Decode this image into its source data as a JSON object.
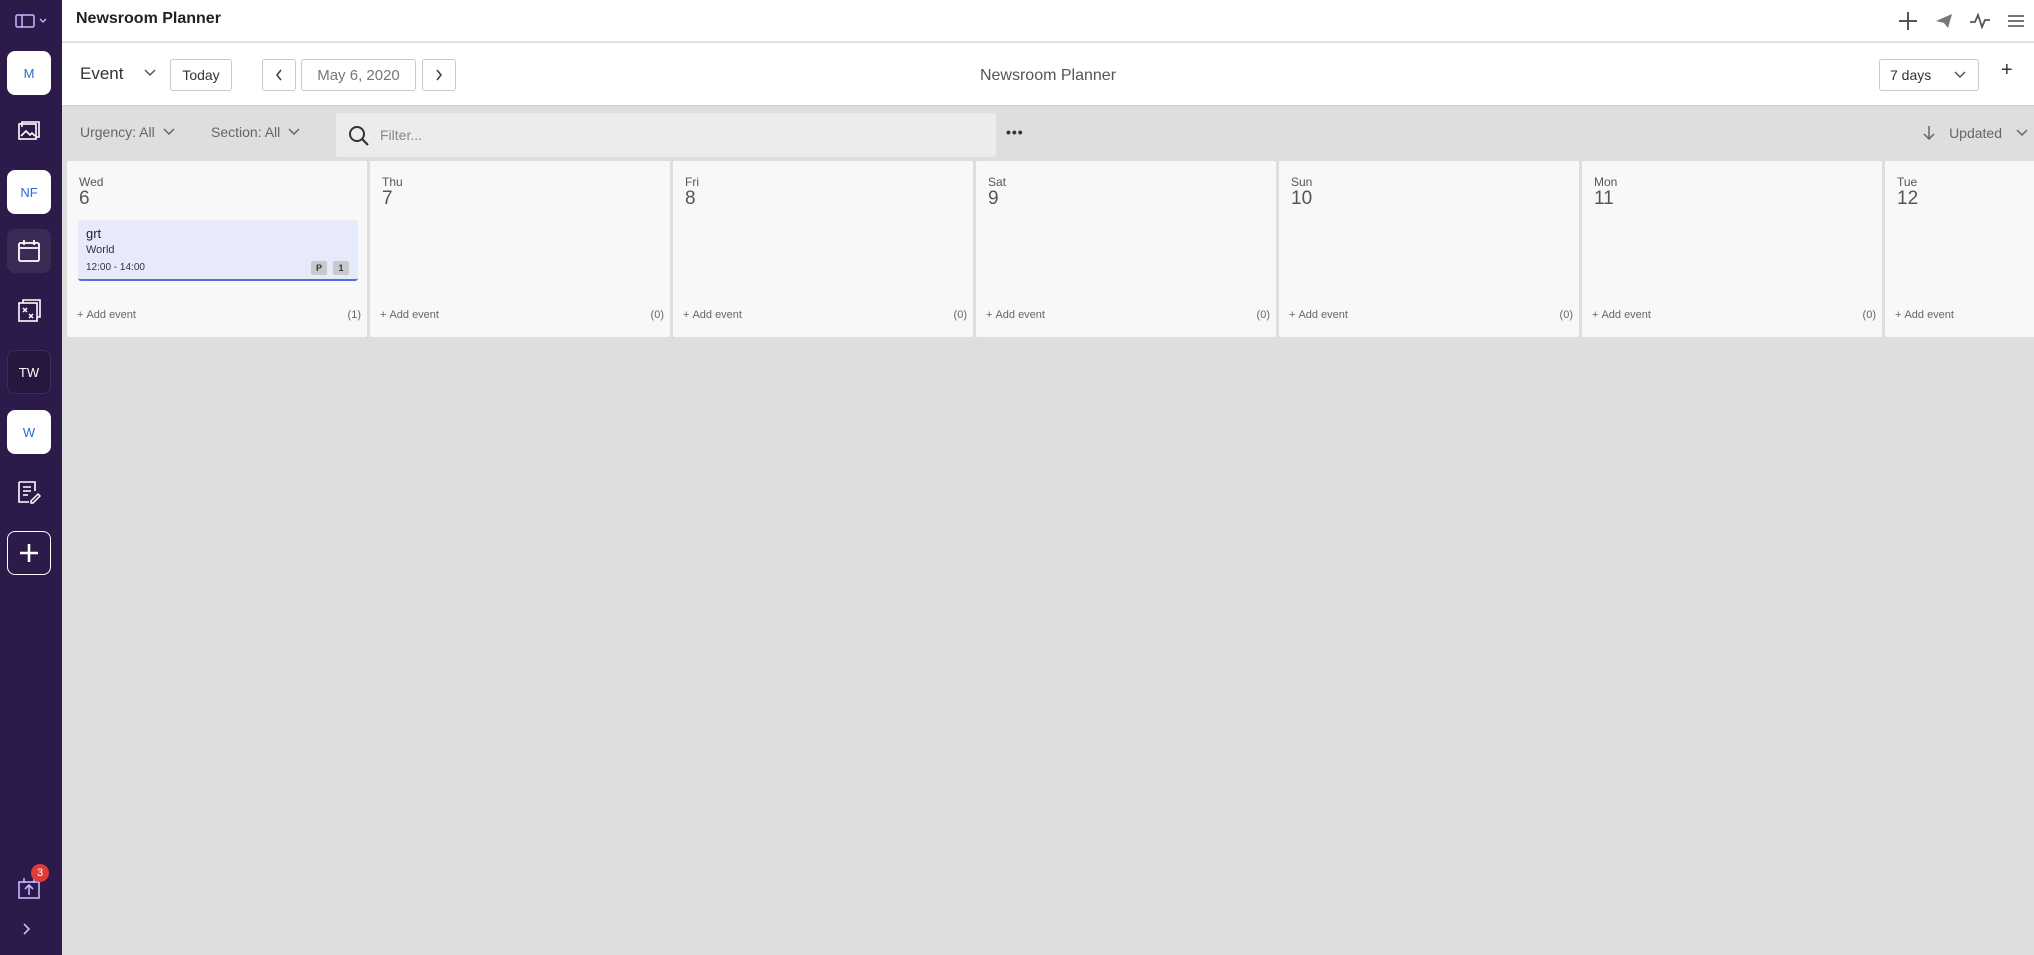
{
  "app": {
    "title": "Newsroom Planner"
  },
  "rail": {
    "items": [
      {
        "label": "M",
        "name": "monitoring"
      },
      {
        "label": "",
        "name": "media"
      },
      {
        "label": "NF",
        "name": "nf-desk"
      },
      {
        "label": "",
        "name": "planning"
      },
      {
        "label": "",
        "name": "assignments"
      },
      {
        "label": "TW",
        "name": "tw-desk"
      },
      {
        "label": "W",
        "name": "w-desk"
      },
      {
        "label": "",
        "name": "content"
      },
      {
        "label": "",
        "name": "create"
      }
    ],
    "notifications_count": "3"
  },
  "toolbar": {
    "type_label": "Event",
    "today_label": "Today",
    "date_value": "May 6, 2020",
    "center_title": "Newsroom Planner",
    "range_label": "7 days",
    "add_label": "+"
  },
  "filters": {
    "urgency_label": "Urgency: All",
    "section_label": "Section: All",
    "search_placeholder": "Filter...",
    "more_label": "•••",
    "sort_label": "Updated"
  },
  "calendar": {
    "days": [
      {
        "name": "Wed",
        "date": "6",
        "count": "(1)",
        "add_label": "Add event",
        "events": [
          {
            "title": "grt",
            "section": "World",
            "time": "12:00 - 14:00",
            "tags": [
              "P",
              "1"
            ]
          }
        ]
      },
      {
        "name": "Thu",
        "date": "7",
        "count": "(0)",
        "add_label": "Add event",
        "events": []
      },
      {
        "name": "Fri",
        "date": "8",
        "count": "(0)",
        "add_label": "Add event",
        "events": []
      },
      {
        "name": "Sat",
        "date": "9",
        "count": "(0)",
        "add_label": "Add event",
        "events": []
      },
      {
        "name": "Sun",
        "date": "10",
        "count": "(0)",
        "add_label": "Add event",
        "events": []
      },
      {
        "name": "Mon",
        "date": "11",
        "count": "(0)",
        "add_label": "Add event",
        "events": []
      },
      {
        "name": "Tue",
        "date": "12",
        "count": "",
        "add_label": "Add event",
        "events": []
      }
    ]
  },
  "colors": {
    "rail_bg": "#2c1a4a",
    "event_bg": "#e6eafa",
    "event_accent": "#4f6fd6",
    "badge": "#e03b3b"
  },
  "icons": [
    "sidebar-toggle-icon",
    "plus-icon",
    "send-icon",
    "activity-icon",
    "menu-icon",
    "search-icon",
    "arrow-down-icon",
    "chevron-down-icon",
    "chevron-left-icon",
    "chevron-right-icon",
    "calendar-icon",
    "image-icon",
    "assignment-icon",
    "notes-icon",
    "upload-icon"
  ]
}
